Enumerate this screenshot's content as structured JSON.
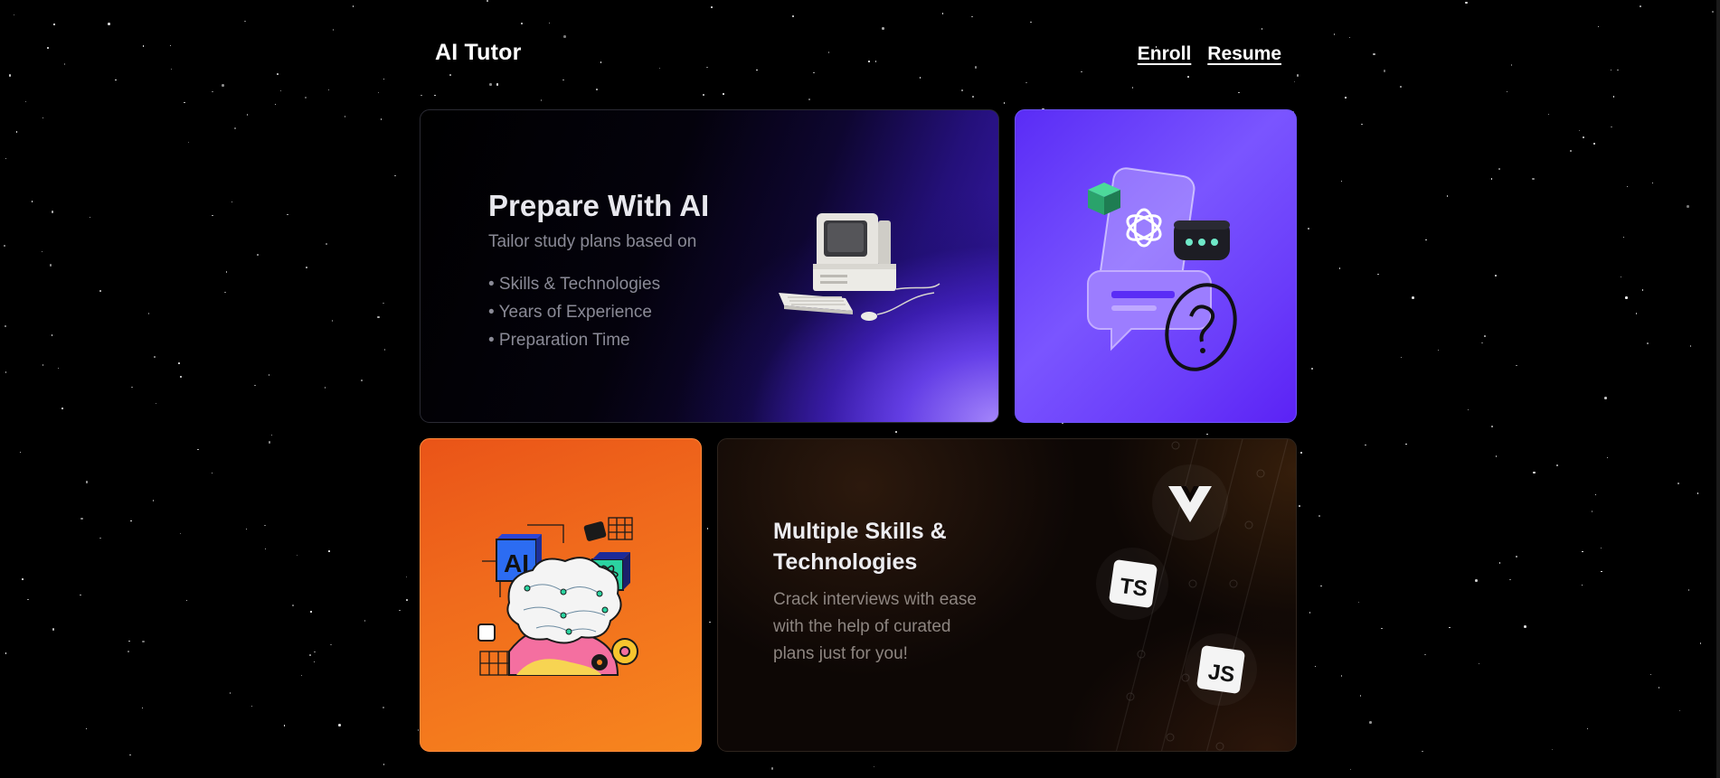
{
  "header": {
    "brand": "AI Tutor",
    "nav": [
      "Enroll",
      "Resume"
    ]
  },
  "prepare_card": {
    "title": "Prepare With AI",
    "subtitle": "Tailor study plans based on",
    "items": [
      "• Skills & Technologies",
      "• Years of Experience",
      "• Preparation Time"
    ]
  },
  "skills_card": {
    "title_line1": "Multiple Skills &",
    "title_line2": "Technologies",
    "desc_line1": "Crack interviews with ease",
    "desc_line2": "with the help of curated",
    "desc_line3": "plans just for you!",
    "logos": {
      "ts": "TS",
      "js": "JS"
    }
  },
  "brain_card": {
    "label": "AI"
  },
  "colors": {
    "purple_accent": "#6a3cfa",
    "orange_accent": "#f06a1c",
    "background": "#000000"
  },
  "icons": [
    "retro-computer-icon",
    "chatgpt-phone-icon",
    "ai-brain-icon",
    "vue-logo-icon",
    "typescript-logo-icon",
    "javascript-logo-icon"
  ]
}
